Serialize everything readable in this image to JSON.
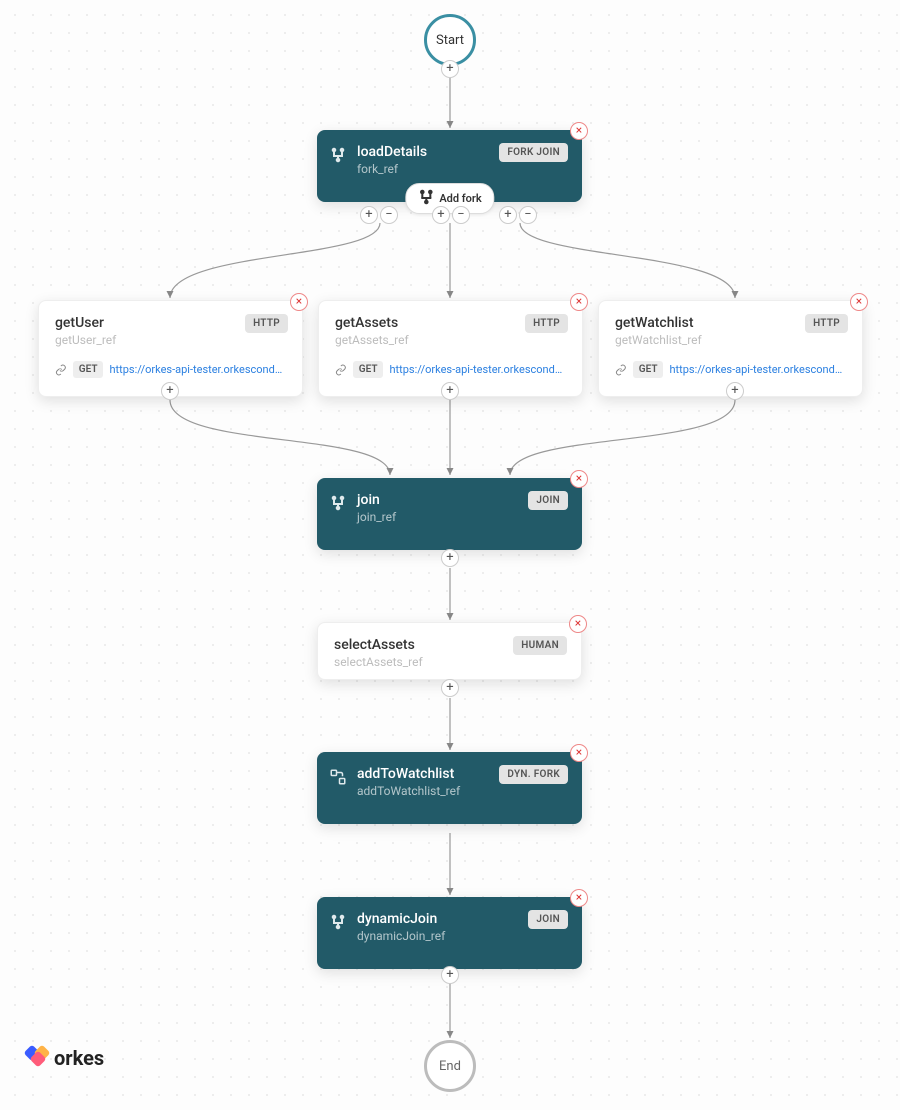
{
  "start": {
    "label": "Start"
  },
  "end": {
    "label": "End"
  },
  "fork": {
    "name": "loadDetails",
    "ref": "fork_ref",
    "badge": "FORK JOIN",
    "addfork_label": "Add fork"
  },
  "branches": [
    {
      "name": "getUser",
      "ref": "getUser_ref",
      "badge": "HTTP",
      "method": "GET",
      "url": "https://orkes-api-tester.orkescondu..."
    },
    {
      "name": "getAssets",
      "ref": "getAssets_ref",
      "badge": "HTTP",
      "method": "GET",
      "url": "https://orkes-api-tester.orkescondu..."
    },
    {
      "name": "getWatchlist",
      "ref": "getWatchlist_ref",
      "badge": "HTTP",
      "method": "GET",
      "url": "https://orkes-api-tester.orkescondu..."
    }
  ],
  "join": {
    "name": "join",
    "ref": "join_ref",
    "badge": "JOIN"
  },
  "human": {
    "name": "selectAssets",
    "ref": "selectAssets_ref",
    "badge": "HUMAN"
  },
  "dynfork": {
    "name": "addToWatchlist",
    "ref": "addToWatchlist_ref",
    "badge": "DYN. FORK"
  },
  "dynjoin": {
    "name": "dynamicJoin",
    "ref": "dynamicJoin_ref",
    "badge": "JOIN"
  },
  "brand": "orkes"
}
